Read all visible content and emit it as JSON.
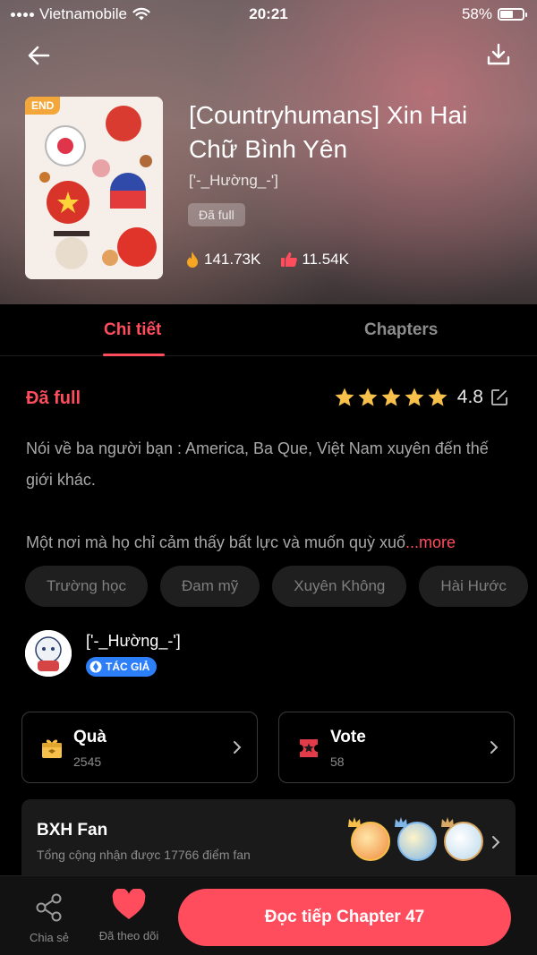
{
  "status_bar": {
    "carrier": "Vietnamobile",
    "time": "20:21",
    "battery": "58%",
    "battery_level": 0.58
  },
  "header": {
    "badge": "END",
    "title": "[Countryhumans] Xin Hai Chữ Bình Yên",
    "author": "['-_Hường_-']",
    "status_badge": "Đã full",
    "views": "141.73K",
    "likes": "11.54K"
  },
  "tabs": [
    {
      "label": "Chi tiết",
      "active": true
    },
    {
      "label": "Chapters",
      "active": false
    }
  ],
  "detail": {
    "status": "Đã full",
    "rating": {
      "value": "4.8",
      "stars": 5
    },
    "description": [
      "Nói về ba người bạn : America, Ba Que, Việt Nam xuyên đến thế giới khác.",
      "Một nơi mà họ chỉ cảm thấy bất lực và muốn quỳ xuố"
    ],
    "more_label": "...more",
    "tags": [
      "Trường học",
      "Đam mỹ",
      "Xuyên Không",
      "Hài Hước"
    ],
    "author": {
      "name": "['-_Hường_-']",
      "badge": "TÁC GIẢ"
    },
    "gift": {
      "label": "Quà",
      "count": "2545"
    },
    "vote": {
      "label": "Vote",
      "count": "58"
    },
    "fan": {
      "title": "BXH Fan",
      "subtitle": "Tổng cộng nhận được 17766 điểm fan"
    }
  },
  "bottom_bar": {
    "share_label": "Chia sẻ",
    "follow_label": "Đã theo dõi",
    "read_label": "Đọc tiếp Chapter 47"
  },
  "colors": {
    "accent": "#ff4d5e",
    "background": "#000000",
    "star": "#f6c04a"
  }
}
